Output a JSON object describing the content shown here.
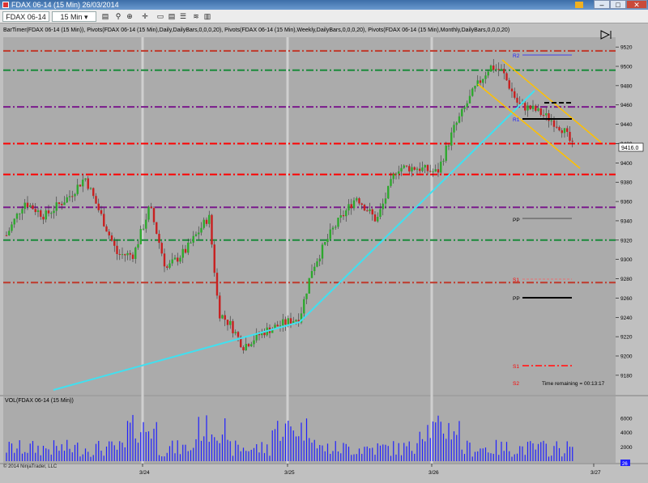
{
  "window": {
    "title": "FDAX 06-14 (15 Min)  26/03/2014"
  },
  "toolbar": {
    "instrument": "FDAX 06-14",
    "interval": "15 Min"
  },
  "indicator_label": "BarTimer(FDAX 06-14 (15 Min)), Pivots(FDAX 06-14 (15 Min),Daily,DailyBars,0,0,0,20), Pivots(FDAX 06-14 (15 Min),Weekly,DailyBars,0,0,0,20), Pivots(FDAX 06-14 (15 Min),Monthly,DailyBars,0,0,0,20)",
  "volume_label": "VOL(FDAX 06-14 (15 Min))",
  "copyright": "© 2014 NinjaTrader, LLC",
  "current_price": "9416.0",
  "time_remaining": "Time remaining = 00:13:17",
  "pivot_labels": {
    "r2": "R2",
    "r1": "R1",
    "pp": "PP",
    "pp2": "PP",
    "s1": "S1",
    "s1b": "S1",
    "s2": "S2"
  },
  "volume_tag": "26",
  "chart_data": {
    "type": "candlestick",
    "price_axis": {
      "min": 9170,
      "max": 9530,
      "ticks": [
        9180,
        9200,
        9220,
        9240,
        9260,
        9280,
        9300,
        9320,
        9340,
        9360,
        9380,
        9400,
        9420,
        9440,
        9460,
        9480,
        9500,
        9520
      ]
    },
    "date_labels": [
      "3/24",
      "3/25",
      "3/26",
      "3/27"
    ],
    "volume_axis": {
      "ticks": [
        2000,
        4000,
        6000
      ]
    },
    "levels": [
      {
        "price": 9516,
        "color": "#c0392b"
      },
      {
        "price": 9496,
        "color": "#1a8a3a"
      },
      {
        "price": 9458,
        "color": "#7a1a8c"
      },
      {
        "price": 9420,
        "color": "#ff0000"
      },
      {
        "price": 9388,
        "color": "#ff0000"
      },
      {
        "price": 9354,
        "color": "#7a1a8c"
      },
      {
        "price": 9320,
        "color": "#1a8a3a"
      },
      {
        "price": 9276,
        "color": "#c0392b"
      }
    ],
    "colors": {
      "up": "#2ea82e",
      "down": "#c82020",
      "trend": "#40e0f0",
      "channel": "#ffc000",
      "volume": "#2020ff",
      "background": "#c0c0c0",
      "panel": "#ababab"
    }
  }
}
